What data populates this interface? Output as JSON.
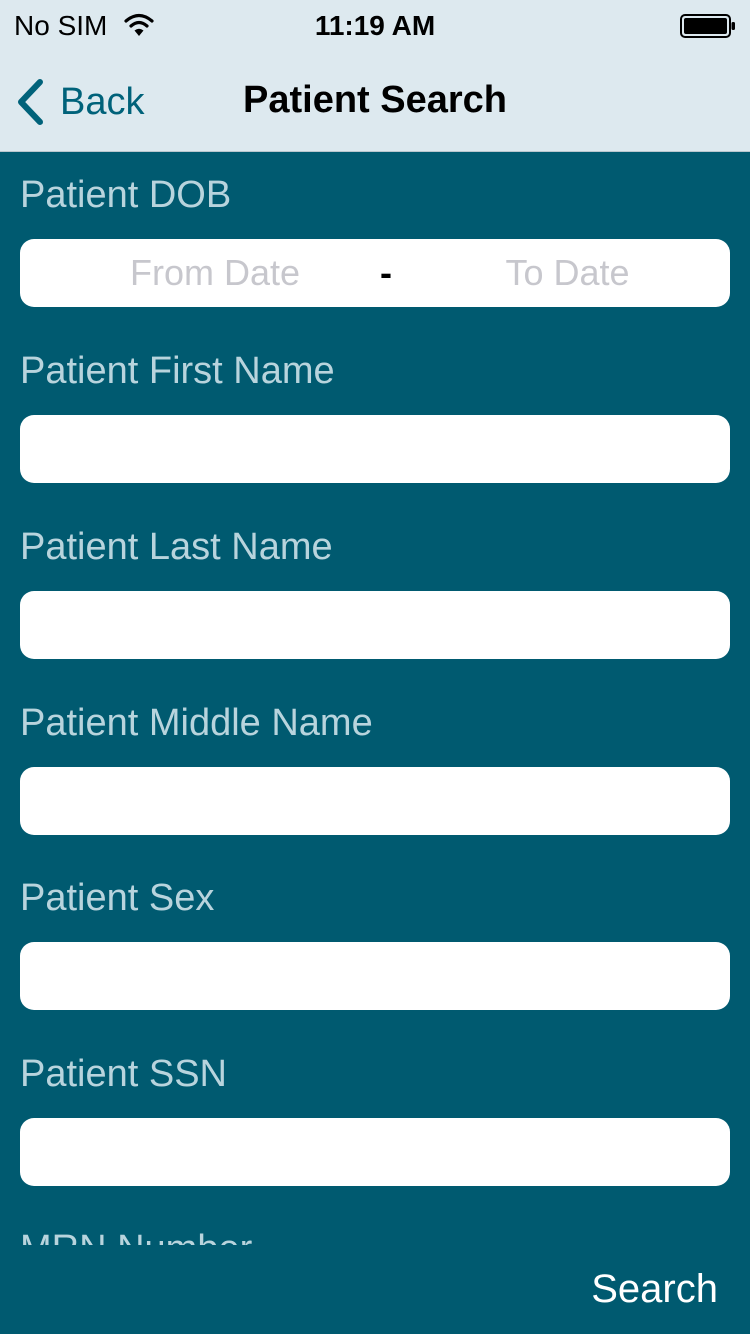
{
  "status_bar": {
    "carrier": "No SIM",
    "time": "11:19 AM",
    "wifi_icon": "wifi-icon",
    "battery_icon": "battery-icon"
  },
  "nav": {
    "back_label": "Back",
    "back_icon": "chevron-left-icon",
    "title": "Patient Search"
  },
  "form": {
    "dob": {
      "label": "Patient DOB",
      "from_placeholder": "From Date",
      "separator": "-",
      "to_placeholder": "To Date"
    },
    "first_name": {
      "label": "Patient First Name",
      "value": ""
    },
    "last_name": {
      "label": "Patient Last Name",
      "value": ""
    },
    "middle_name": {
      "label": "Patient Middle Name",
      "value": ""
    },
    "sex": {
      "label": "Patient Sex",
      "value": ""
    },
    "ssn": {
      "label": "Patient SSN",
      "value": ""
    },
    "mrn": {
      "label": "MRN Number"
    }
  },
  "footer": {
    "search_label": "Search"
  },
  "colors": {
    "background": "#005a70",
    "nav_background": "#dde9ef",
    "accent": "#00627a",
    "label_text": "#b8d4dd"
  }
}
